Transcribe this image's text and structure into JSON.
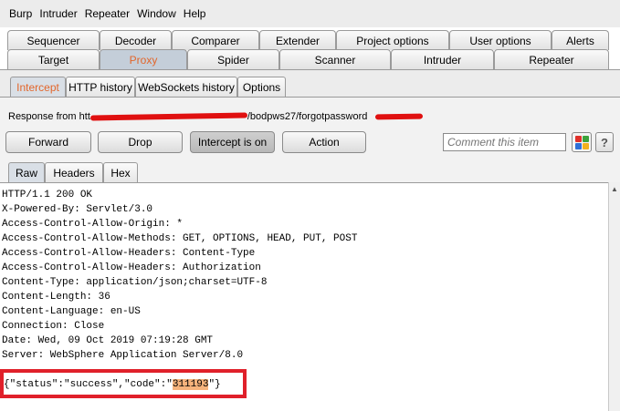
{
  "menu": [
    "Burp",
    "Intruder",
    "Repeater",
    "Window",
    "Help"
  ],
  "tabs_row1": [
    "Sequencer",
    "Decoder",
    "Comparer",
    "Extender",
    "Project options",
    "User options",
    "Alerts"
  ],
  "tabs_row2": [
    "Target",
    "Proxy",
    "Spider",
    "Scanner",
    "Intruder",
    "Repeater"
  ],
  "active_tab": "Proxy",
  "proxy_tabs": [
    "Intercept",
    "HTTP history",
    "WebSockets history",
    "Options"
  ],
  "active_proxy_tab": "Intercept",
  "response": {
    "prefix": "Response from htt",
    "path": "/bodpws27/forgotpassword"
  },
  "buttons": {
    "forward": "Forward",
    "drop": "Drop",
    "intercept": "Intercept is on",
    "action": "Action"
  },
  "comment_placeholder": "Comment this item",
  "color_swatches": [
    "#e0302a",
    "#3ca23c",
    "#2f6fd6",
    "#f2b01e"
  ],
  "help_label": "?",
  "view_tabs": [
    "Raw",
    "Headers",
    "Hex"
  ],
  "active_view_tab": "Raw",
  "headers": [
    "HTTP/1.1 200 OK",
    "X-Powered-By: Servlet/3.0",
    "Access-Control-Allow-Origin: *",
    "Access-Control-Allow-Methods: GET, OPTIONS, HEAD, PUT, POST",
    "Access-Control-Allow-Headers: Content-Type",
    "Access-Control-Allow-Headers: Authorization",
    "Content-Type: application/json;charset=UTF-8",
    "Content-Length: 36",
    "Content-Language: en-US",
    "Connection: Close",
    "Date: Wed, 09 Oct 2019 07:19:28 GMT",
    "Server: WebSphere Application Server/8.0"
  ],
  "body_json": {
    "prefix": "{\"status\":\"success\",\"code\":\"",
    "code": "311193",
    "suffix": "\"}"
  },
  "colors": {
    "active_tab_text": "#e2662b",
    "highlight_border": "#e0202a",
    "code_highlight": "#f6b37c"
  }
}
